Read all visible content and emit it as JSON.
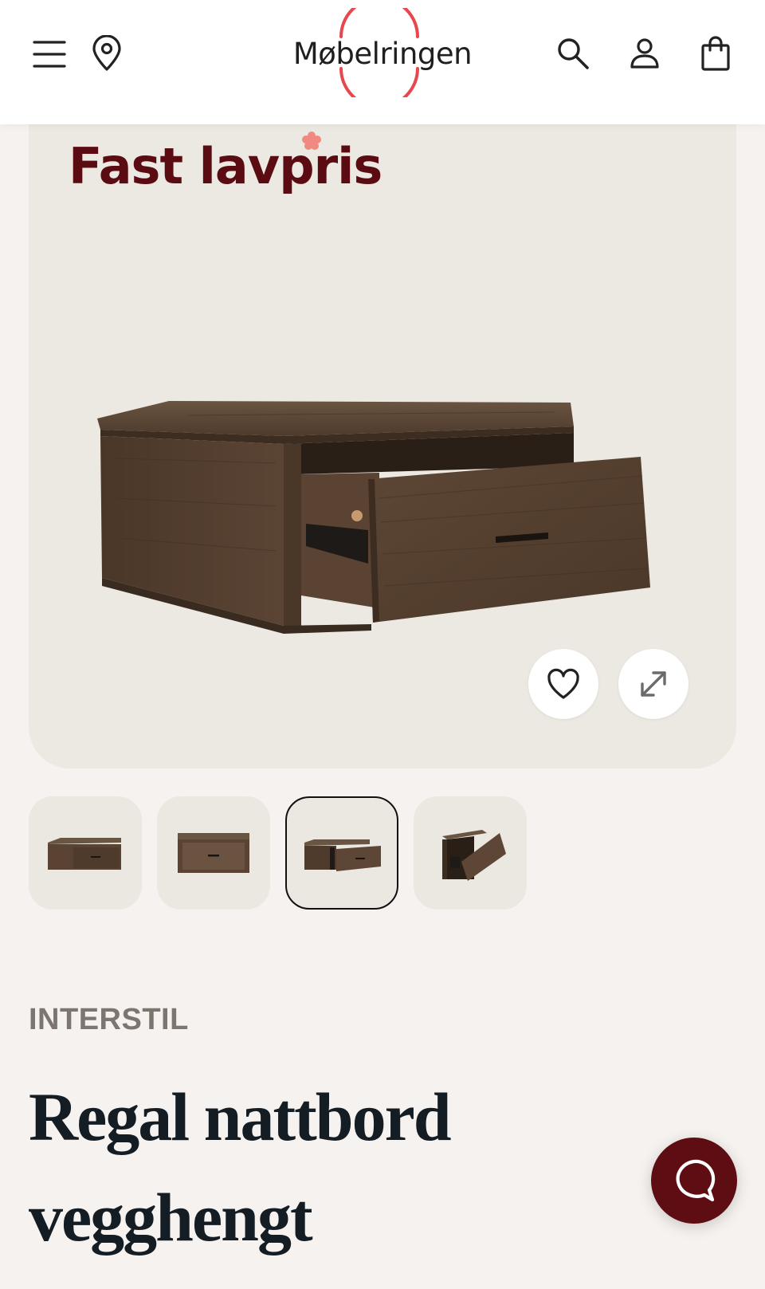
{
  "header": {
    "logo_text": "Møbelringen",
    "icons": [
      "menu-icon",
      "location-pin-icon",
      "search-icon",
      "user-icon",
      "shopping-bag-icon"
    ],
    "logo_ring_color": "#e8484d"
  },
  "hero": {
    "badge_text": "Fast lavpris",
    "badge_color": "#5b0c12",
    "badge_accent_color": "#f08a80",
    "favorite_icon": "heart-icon",
    "expand_icon": "expand-icon"
  },
  "thumbnails": {
    "count": 4,
    "selected_index": 2
  },
  "product": {
    "brand": "INTERSTIL",
    "title": "Regal nattbord vegghengt"
  },
  "chat": {
    "icon": "chat-bubble-icon",
    "color": "#5e0d12"
  }
}
